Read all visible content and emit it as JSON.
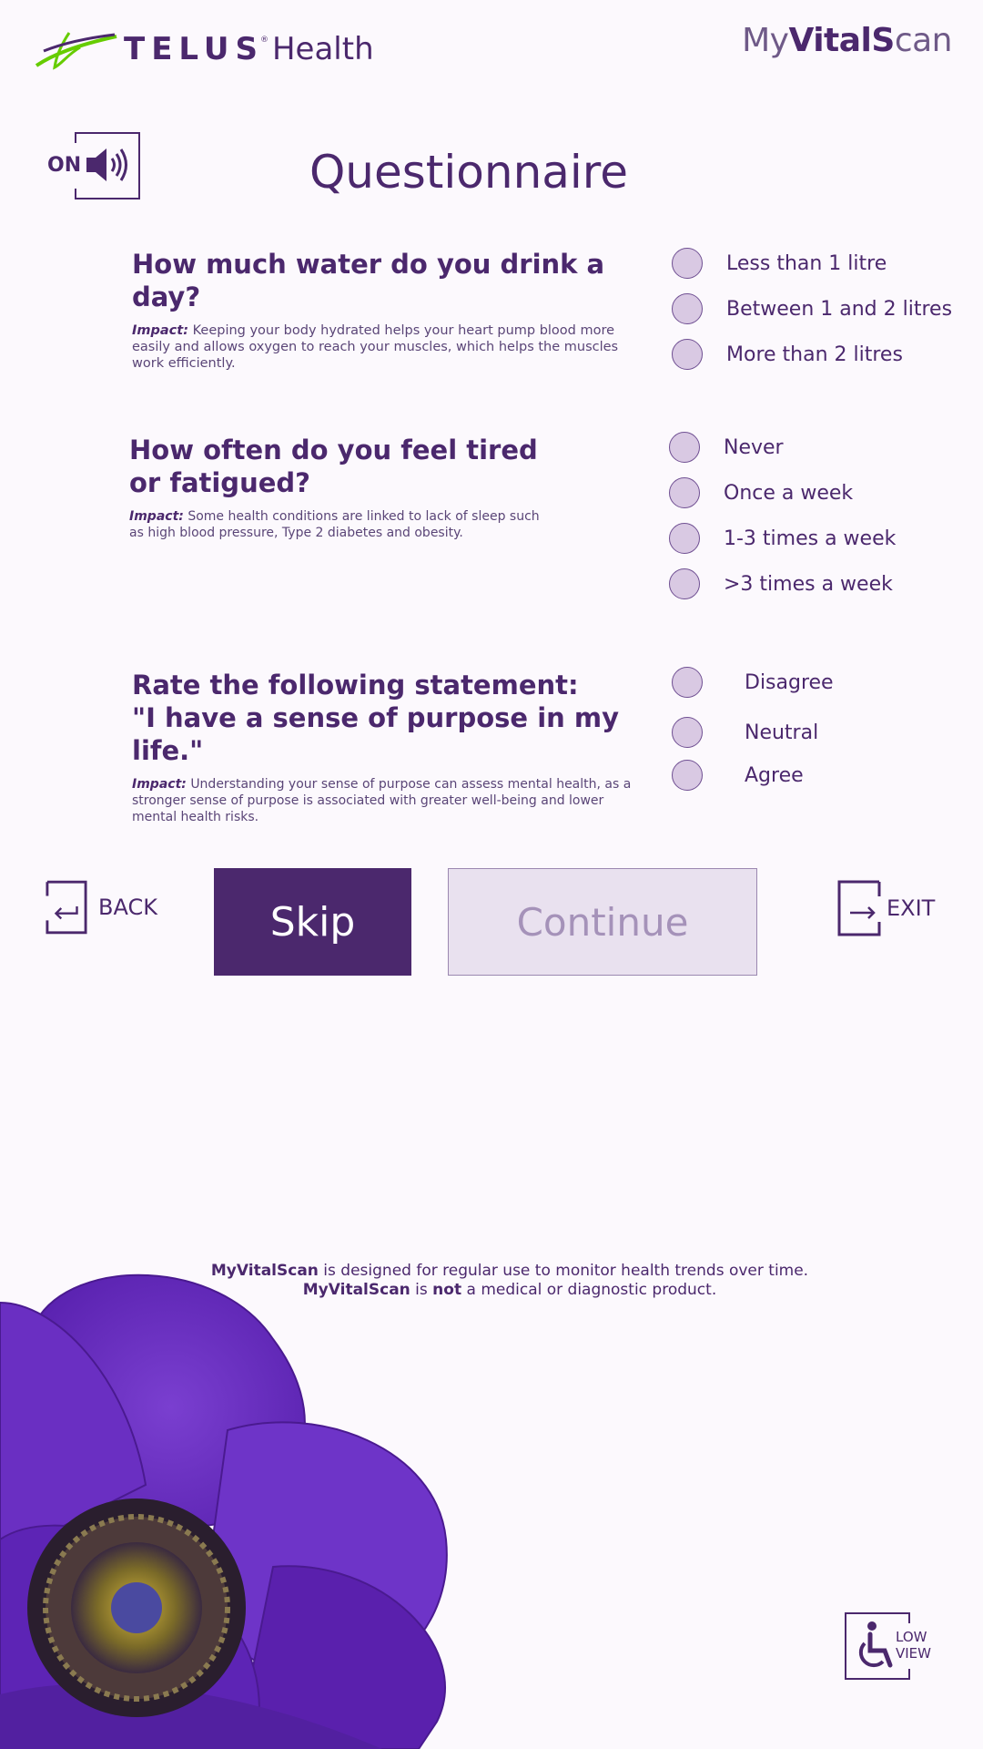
{
  "header": {
    "brand_word": "TELUS",
    "brand_reg": "®",
    "brand_suffix": "Health",
    "product_my": "My",
    "product_vital": "VitalS",
    "product_can": "can"
  },
  "sound": {
    "state_label": "ON",
    "icon": "speaker-icon"
  },
  "page_title": "Questionnaire",
  "impact_label": "Impact:",
  "questions": [
    {
      "title": "How much water do you drink a day?",
      "impact": "Keeping your body hydrated helps your heart pump blood more easily and allows oxygen to reach your muscles, which helps the muscles work efficiently.",
      "options": [
        "Less than 1 litre",
        "Between 1 and 2 litres",
        "More than 2 litres"
      ]
    },
    {
      "title_line1": "How often do you feel tired",
      "title_line2": "or fatigued?",
      "impact": "Some health conditions are linked to lack of sleep such as high blood pressure, Type 2 diabetes and obesity.",
      "options": [
        "Never",
        "Once a week",
        "1-3 times a week",
        ">3 times a week"
      ]
    },
    {
      "title_line1": "Rate the following statement:",
      "title_line2": "\"I have a sense of purpose in my life.\"",
      "impact": "Understanding your sense of purpose can assess mental health, as a stronger sense of purpose is associated with greater well-being and lower mental health risks.",
      "options": [
        "Disagree",
        "Neutral",
        "Agree"
      ]
    }
  ],
  "nav": {
    "back_label": "BACK",
    "skip_label": "Skip",
    "continue_label": "Continue",
    "exit_label": "EXIT"
  },
  "disclaimer": {
    "p1_bold": "MyVitalScan",
    "p1_text": " is designed for regular use to monitor health trends over time. ",
    "p2_bold": "MyVitalScan",
    "p2_text": " is ",
    "p3_bold": "not",
    "p3_text": " a medical or diagnostic product."
  },
  "accessibility": {
    "line1": "LOW",
    "line2": "VIEW"
  },
  "colors": {
    "brand_purple": "#4b286d",
    "brand_green": "#66cc00",
    "background": "#fcf9fd",
    "radio_fill": "#d9c9e3",
    "continue_disabled_bg": "#e9e1ef",
    "continue_disabled_text": "#a592b9"
  }
}
